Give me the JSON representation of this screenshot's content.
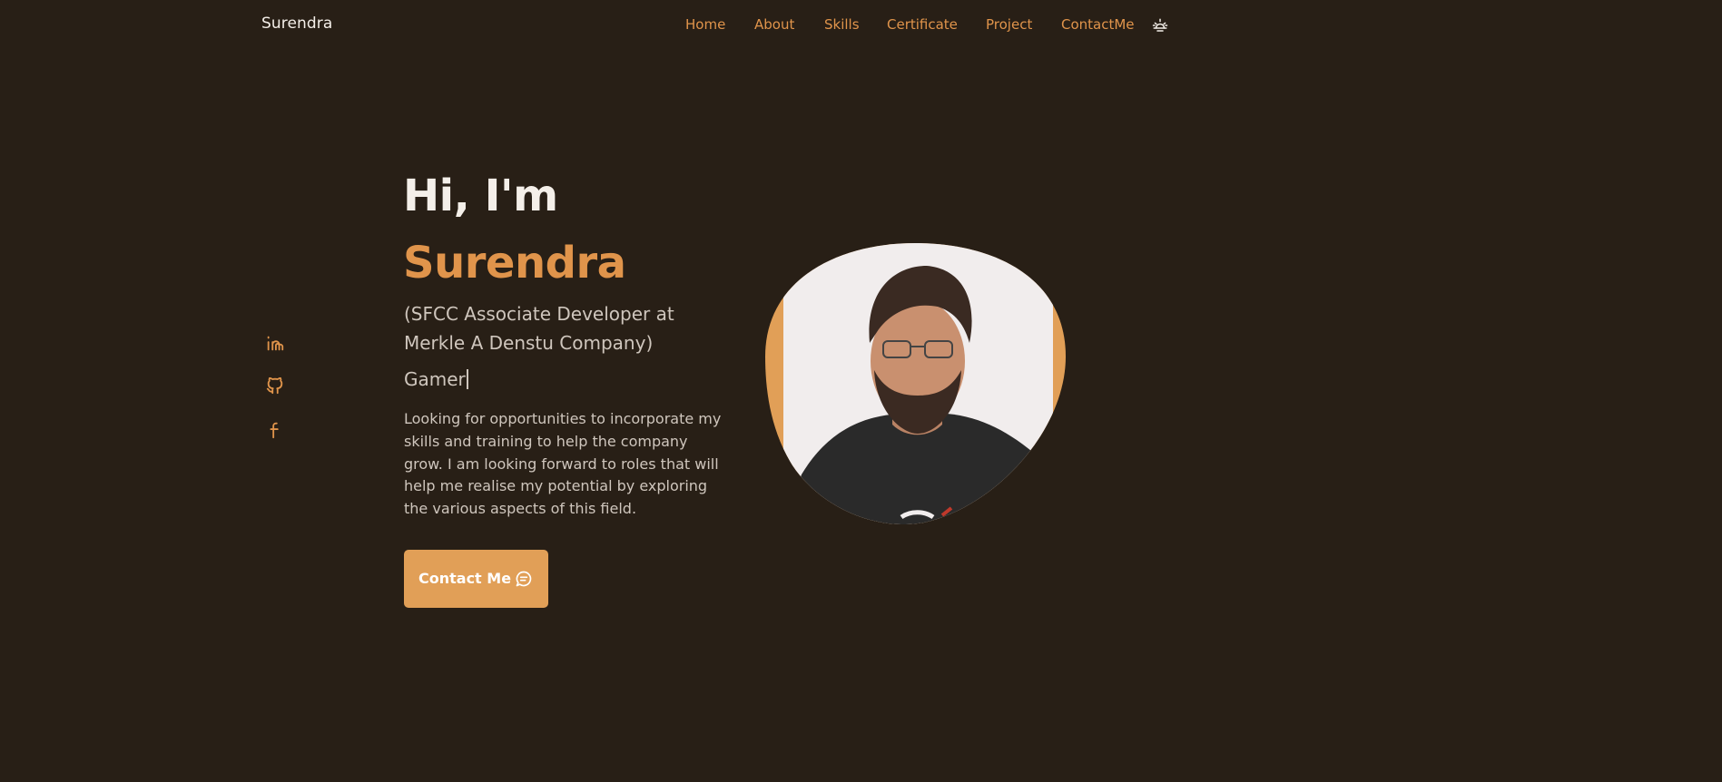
{
  "header": {
    "brand": "Surendra",
    "nav": [
      {
        "label": "Home"
      },
      {
        "label": "About"
      },
      {
        "label": "Skills"
      },
      {
        "label": "Certificate"
      },
      {
        "label": "Project"
      },
      {
        "label": "ContactMe"
      }
    ],
    "theme_icon": "sun-icon"
  },
  "social": [
    {
      "name": "linkedin",
      "icon": "linkedin-icon"
    },
    {
      "name": "github",
      "icon": "github-icon"
    },
    {
      "name": "facebook",
      "icon": "facebook-icon"
    }
  ],
  "hero": {
    "greeting": "Hi, I'm",
    "name": "Surendra",
    "role": "(SFCC Associate Developer at Merkle A Denstu Company)",
    "typing_text": "Gamer",
    "description": "Looking for opportunities to incorporate my skills and training to help the company grow. I am looking forward to roles that will help me realise my potential by exploring the various aspects of this field.",
    "button_label": "Contact Me",
    "button_icon": "message-icon"
  },
  "colors": {
    "background": "#281f16",
    "accent": "#e0944b",
    "button": "#e19f57",
    "text_light": "#f4efe9",
    "text_muted": "#cfc6bd"
  }
}
